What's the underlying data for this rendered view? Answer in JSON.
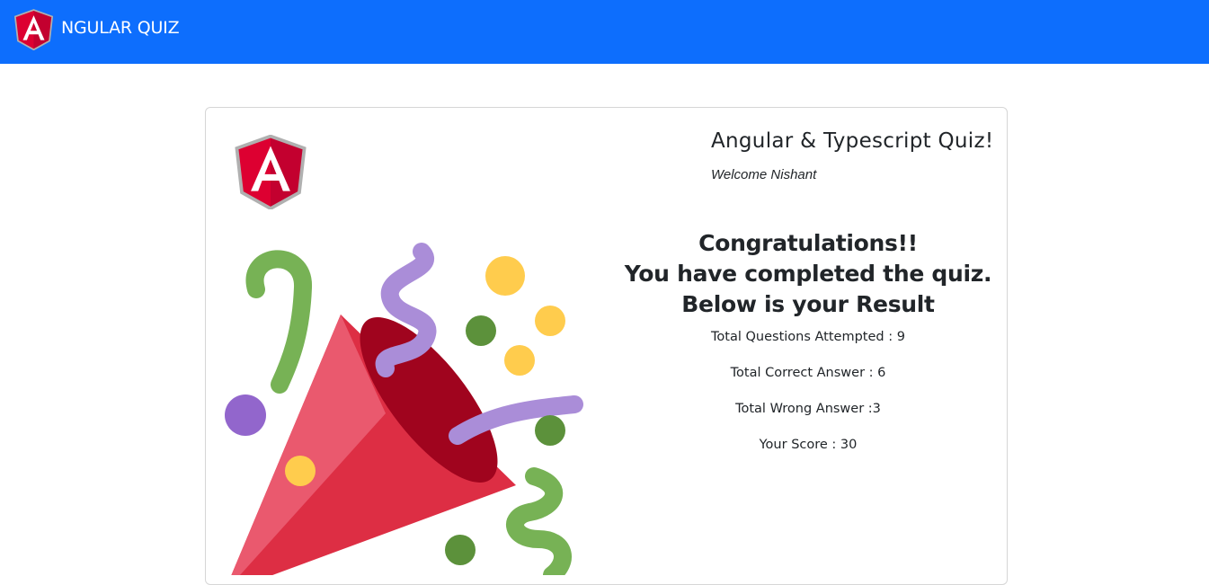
{
  "navbar": {
    "logo_icon": "angular-logo-icon",
    "title": "NGULAR QUIZ",
    "background": "#0d6efd"
  },
  "card": {
    "logo_icon": "angular-logo-icon",
    "illustration": "party-popper-icon",
    "quiz_title": "Angular & Typescript Quiz!",
    "welcome": "Welcome Nishant",
    "result": {
      "line1": "Congratulations!!",
      "line2": "You have completed the quiz.",
      "line3": "Below is your Result",
      "stats": [
        "Total Questions Attempted : 9",
        "Total Correct Answer : 6",
        "Total Wrong Answer :3",
        "Your Score : 30"
      ]
    }
  },
  "colors": {
    "angular_red": "#dd0031",
    "angular_dark_red": "#c3002f",
    "popper_red": "#dd2e44",
    "confetti_green": "#77b255",
    "confetti_purple": "#aa8dd8",
    "confetti_yellow": "#ffcc4d"
  }
}
